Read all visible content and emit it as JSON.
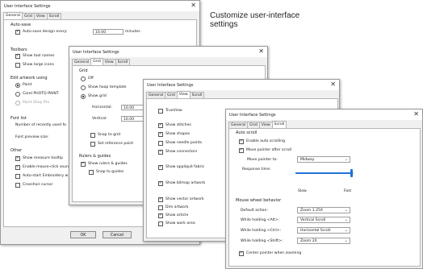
{
  "caption": "Customize user-interface settings",
  "dialog_title": "User Interface Settings",
  "close_glyph": "✕",
  "tab_labels": [
    "General",
    "Grid",
    "View",
    "Scroll"
  ],
  "win1": {
    "autosave": {
      "heading": "Auto-save",
      "checkbox": "Auto-save design every:",
      "value": "10.00",
      "unit": "minutes"
    },
    "toolbars": {
      "heading": "Toolbars",
      "show_tool_names": "Show tool names",
      "show_large_icons": "Show large icons"
    },
    "edit_artwork": {
      "heading": "Edit artwork using",
      "paint": "Paint",
      "corel": "Corel PHOTO-PAINT",
      "paintshop": "Paint Shop Pro"
    },
    "font_list": {
      "heading": "Font list",
      "recent_label": "Number of recently used fo",
      "preview_label": "Font preview size:"
    },
    "other": {
      "heading": "Other",
      "show_measure": "Show measure tooltip",
      "enable_mouse_click": "Enable mouse-click soun",
      "auto_start": "Auto-start Embroidery w",
      "crosshair": "Crosshair cursor"
    },
    "ok": "OK",
    "cancel": "Cancel"
  },
  "win2": {
    "grid": {
      "heading": "Grid",
      "off": "Off",
      "show_hoop_template": "Show hoop template",
      "show_grid": "Show grid",
      "horizontal_label": "Horizontal:",
      "horizontal_value": "10.00",
      "vertical_label": "Vertical:",
      "vertical_value": "10.00",
      "snap_to_grid": "Snap to grid",
      "set_reference_point": "Set reference point"
    },
    "rulers": {
      "heading": "Rulers & guides",
      "show_rulers": "Show rulers & guides",
      "snap_to_guides": "Snap to guides"
    }
  },
  "win3": {
    "trueview": "TrueView",
    "show_stitches": "Show stitches",
    "show_shapes": "Show shapes",
    "show_needle_points": "Show needle points",
    "show_connectors": "Show connectors",
    "show_applique_fabric": "Show appliqué fabric",
    "show_bitmap_artwork": "Show bitmap artwork",
    "show_vector_artwork": "Show vector artwork",
    "dim_artwork": "Dim artwork",
    "show_article": "Show article",
    "show_work_area": "Show work area"
  },
  "win4": {
    "auto_scroll": {
      "heading": "Auto scroll",
      "enable": "Enable auto scrolling",
      "move_pointer_after": "Move pointer after scroll",
      "move_pointer_to_label": "Move pointer to:",
      "move_pointer_to_value": "Midway",
      "response_time_label": "Response time:",
      "slow": "Slow",
      "fast": "Fast",
      "response_level": 0.98
    },
    "wheel": {
      "heading": "Mouse wheel behavior",
      "default_label": "Default action:",
      "default_value": "Zoom 1.25X",
      "alt_label": "While holding <Alt>:",
      "alt_value": "Vertical Scroll",
      "ctrl_label": "While holding <Ctrl>:",
      "ctrl_value": "Horizontal Scroll",
      "shift_label": "While holding <Shift>:",
      "shift_value": "Zoom 2X",
      "center_pointer": "Center pointer when zooming"
    }
  },
  "colors": {
    "window_bg": "#f0f0f0",
    "panel_bg": "#ffffff",
    "slider_accent": "#1e73d6"
  }
}
